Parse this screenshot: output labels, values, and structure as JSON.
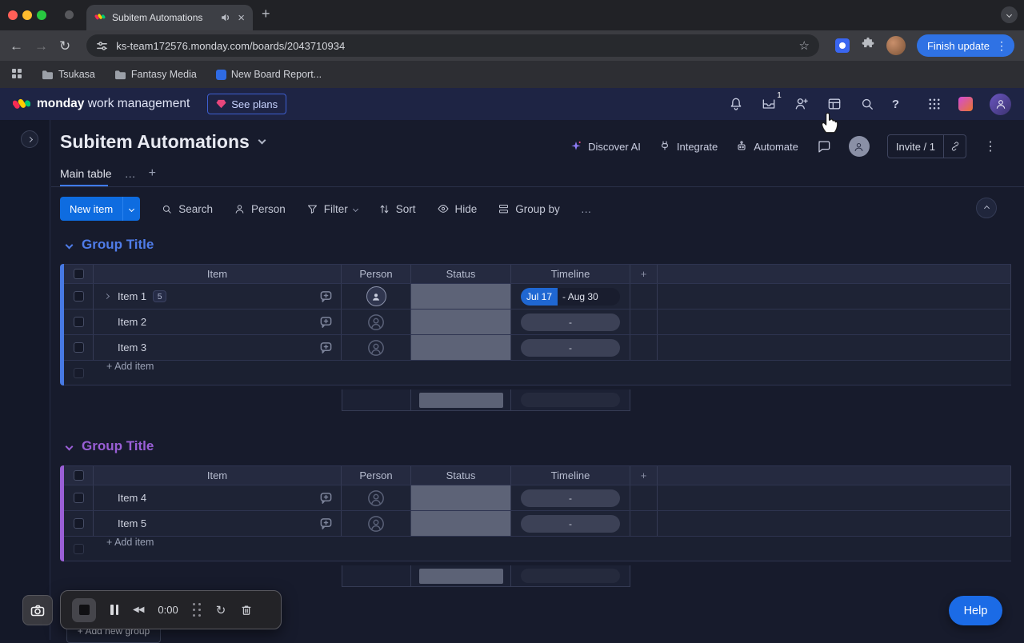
{
  "browser": {
    "tab_title": "Subitem Automations",
    "url": "ks-team172576.monday.com/boards/2043710934",
    "finish_update": "Finish update",
    "bookmarks": [
      {
        "label": "Tsukasa"
      },
      {
        "label": "Fantasy Media"
      },
      {
        "label": "New Board Report..."
      }
    ]
  },
  "app_topbar": {
    "brand_bold": "monday",
    "brand_light": "work management",
    "see_plans": "See plans",
    "inbox_badge": "1"
  },
  "board": {
    "title": "Subitem Automations",
    "discover_ai": "Discover AI",
    "integrate": "Integrate",
    "automate": "Automate",
    "invite": "Invite / 1",
    "tab_main": "Main table"
  },
  "toolbar": {
    "new_item": "New item",
    "search": "Search",
    "person": "Person",
    "filter": "Filter",
    "sort": "Sort",
    "hide": "Hide",
    "group_by": "Group by"
  },
  "table": {
    "columns": {
      "item": "Item",
      "person": "Person",
      "status": "Status",
      "timeline": "Timeline"
    },
    "add_item": "+ Add item",
    "timeline_placeholder": "-"
  },
  "groups": [
    {
      "title": "Group Title",
      "accent": "#4f7ce8",
      "items": [
        {
          "name": "Item 1",
          "subitems": "5",
          "timeline_start": "Jul 17",
          "timeline_end": "- Aug 30"
        },
        {
          "name": "Item 2"
        },
        {
          "name": "Item 3"
        }
      ]
    },
    {
      "title": "Group Title",
      "accent": "#9a5fd6",
      "items": [
        {
          "name": "Item 4"
        },
        {
          "name": "Item 5"
        }
      ]
    }
  ],
  "footer": {
    "add_new_group": "+ Add new group",
    "help": "Help",
    "recorder_time": "0:00"
  },
  "icons": {
    "back": "←",
    "forward": "→",
    "reload": "↻",
    "star": "☆",
    "kebab": "⋮",
    "close": "×",
    "plus": "+",
    "question": "?",
    "ellipsis": "…",
    "rewind": "◀◀",
    "restart": "↻"
  },
  "colors": {
    "primary_blue": "#0e6ce0",
    "group1_accent": "#4f7ce8",
    "group2_accent": "#9a5fd6",
    "help_button": "#1b6be6",
    "timeline_selection": "#1f67d2"
  }
}
